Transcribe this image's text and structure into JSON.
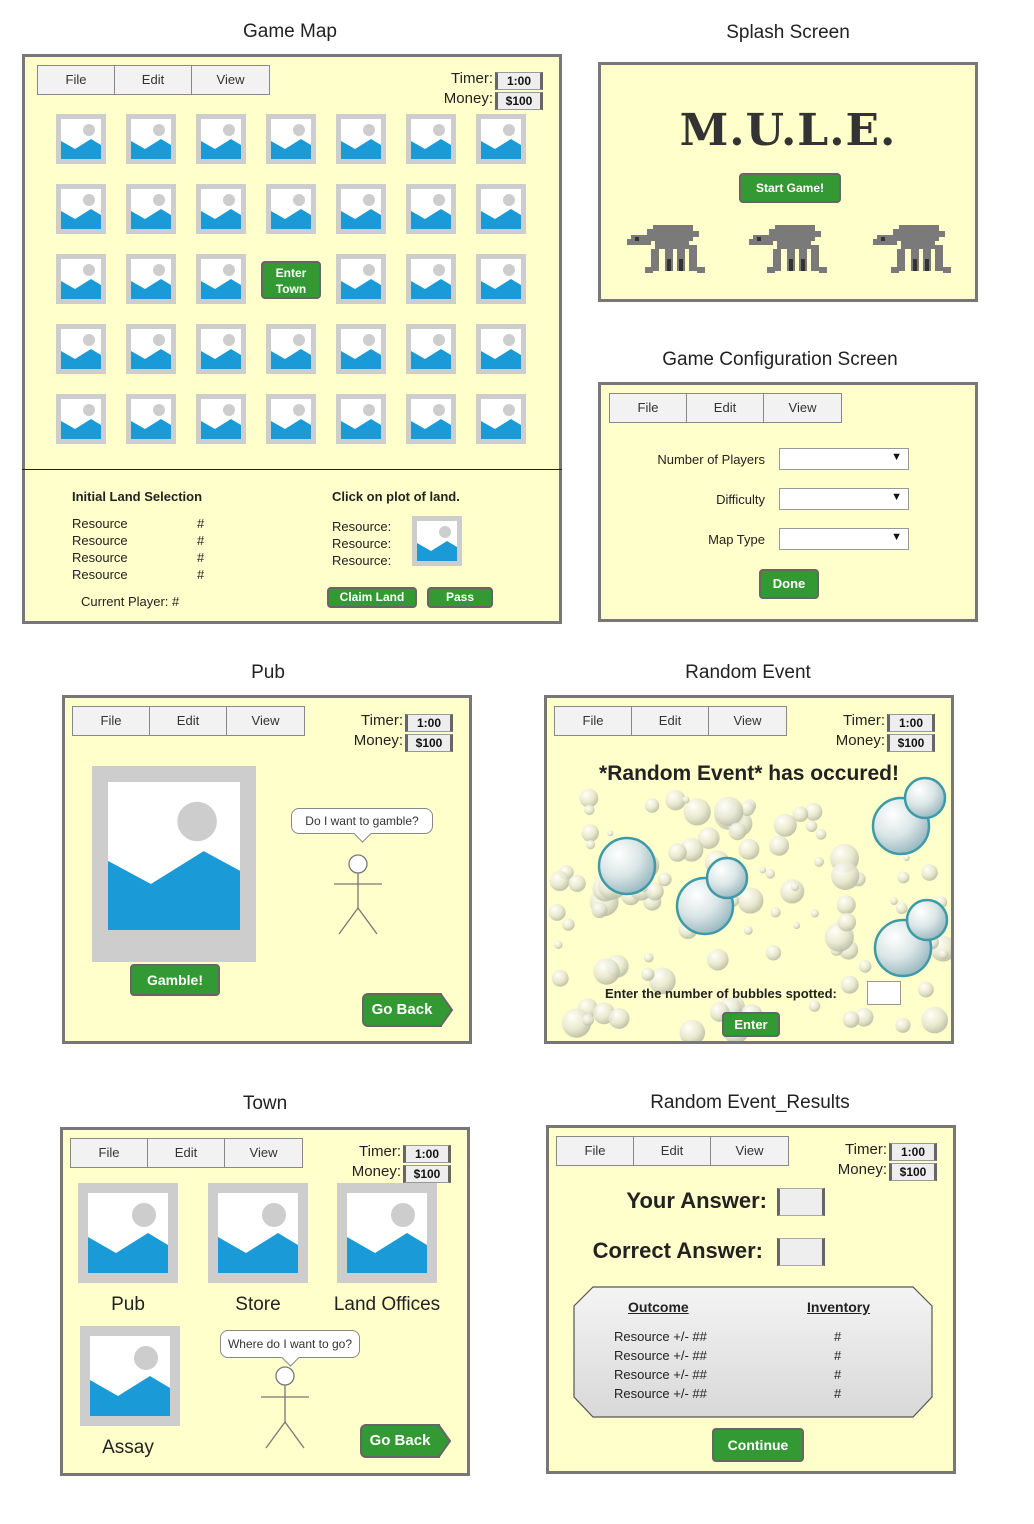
{
  "menu": {
    "file": "File",
    "edit": "Edit",
    "view": "View"
  },
  "stats": {
    "timer_label": "Timer:",
    "timer_value": "1:00",
    "money_label": "Money:",
    "money_value": "$100"
  },
  "game_map": {
    "title": "Game Map",
    "enter_town": "Enter Town",
    "initial_selection": "Initial Land Selection",
    "resource_rows": [
      {
        "label": "Resource",
        "value": "#"
      },
      {
        "label": "Resource",
        "value": "#"
      },
      {
        "label": "Resource",
        "value": "#"
      },
      {
        "label": "Resource",
        "value": "#"
      }
    ],
    "current_player": "Current Player: #",
    "click_hint": "Click on plot of land.",
    "plot_resources": [
      "Resource:",
      "Resource:",
      "Resource:"
    ],
    "claim_land": "Claim Land",
    "pass": "Pass"
  },
  "splash": {
    "title": "Splash Screen",
    "logo": "M.U.L.E.",
    "start": "Start Game!"
  },
  "config": {
    "title": "Game Configuration Screen",
    "fields": [
      "Number of Players",
      "Difficulty",
      "Map Type"
    ],
    "done": "Done"
  },
  "pub": {
    "title": "Pub",
    "gamble": "Gamble!",
    "speech": "Do I want to gamble?",
    "go_back": "Go Back"
  },
  "random_event": {
    "title": "Random Event",
    "headline": "*Random Event* has occured!",
    "prompt": "Enter the number of bubbles spotted:",
    "enter": "Enter"
  },
  "town": {
    "title": "Town",
    "places": [
      "Pub",
      "Store",
      "Land Offices",
      "Assay"
    ],
    "speech": "Where do I want to go?",
    "go_back": "Go Back"
  },
  "results": {
    "title": "Random Event_Results",
    "your_answer": "Your Answer:",
    "correct_answer": "Correct Answer:",
    "outcome_header": "Outcome",
    "inventory_header": "Inventory",
    "rows": [
      {
        "outcome": "Resource +/- ##",
        "inventory": "#"
      },
      {
        "outcome": "Resource +/- ##",
        "inventory": "#"
      },
      {
        "outcome": "Resource +/- ##",
        "inventory": "#"
      },
      {
        "outcome": "Resource +/- ##",
        "inventory": "#"
      }
    ],
    "continue": "Continue"
  },
  "colors": {
    "panel_bg": "#ffffcc",
    "button_green": "#339933",
    "image_blue": "#1a9ad6",
    "image_gray": "#cdcdcd"
  }
}
